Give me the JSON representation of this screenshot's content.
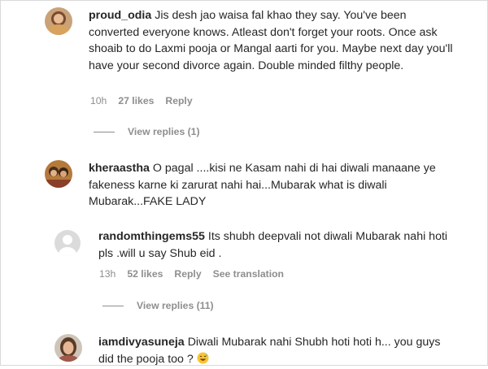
{
  "comments": [
    {
      "username": "proud_odia",
      "text": "Jis desh jao waisa fal khao they say. You've been converted everyone knows. Atleast don't forget your roots. Once ask shoaib to do Laxmi pooja or Mangal aarti for you. Maybe next day you'll have your second divorce again. Double minded filthy people.",
      "time": "10h",
      "likes": "27 likes",
      "reply": "Reply",
      "view_replies": "View replies (1)"
    },
    {
      "username": "kheraastha",
      "text": "O pagal ....kisi ne Kasam nahi di hai diwali manaane ye fakeness karne ki zarurat nahi hai...Mubarak what is diwali Mubarak...FAKE LADY",
      "reply_item": {
        "username": "randomthingems55",
        "text": "Its shubh deepvali not diwali Mubarak nahi hoti pls .will u say Shub eid .",
        "time": "13h",
        "likes": "52 likes",
        "reply": "Reply",
        "translation": "See translation"
      },
      "view_replies": "View replies (11)"
    },
    {
      "username": "iamdivyasuneja",
      "text": "Diwali Mubarak nahi Shubh hoti hoti h... you guys did the pooja too ?",
      "emoji": "grinning-sweat-emoji"
    }
  ],
  "colors": {
    "text": "#262626",
    "meta": "#8e8e8e",
    "border": "#d9d9d9"
  }
}
